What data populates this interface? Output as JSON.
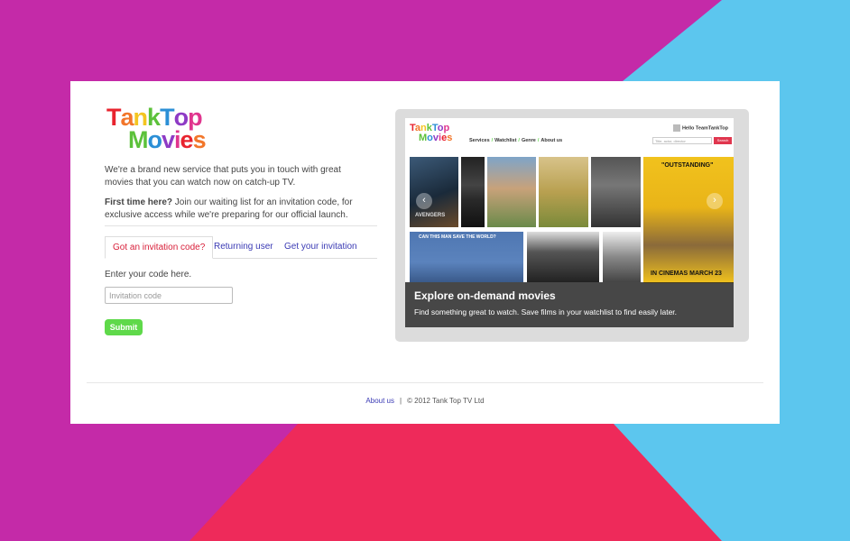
{
  "brand": {
    "line1": "TankTop",
    "line2": "Movies",
    "colors": [
      "#e8232e",
      "#f2762a",
      "#f4c520",
      "#5cc13a",
      "#2b8fd6",
      "#8e3bc5",
      "#e0358e"
    ]
  },
  "intro": {
    "text": "We're a brand new service that puts you in touch with great movies that you can watch now on catch-up TV.",
    "first_time_strong": "First time here?",
    "first_time_rest": " Join our waiting list for an invitation code, for exclusive access while we're preparing for our official launch."
  },
  "tabs": [
    {
      "label": "Got an invitation code?",
      "active": true
    },
    {
      "label": "Returning user",
      "active": false
    },
    {
      "label": "Get your invitation",
      "active": false
    }
  ],
  "form": {
    "code_label": "Enter your code here.",
    "code_placeholder": "Invitation code",
    "code_value": "",
    "submit_label": "Submit"
  },
  "preview": {
    "logo_line1": "TankTop",
    "logo_line2": "Movies",
    "nav": [
      "Services",
      "Watchlist",
      "Genre",
      "About us"
    ],
    "user_greeting": "Hello TeamTankTop",
    "search_placeholder": "Title, actor, director",
    "search_button": "Search",
    "caption_heading": "Explore on-demand movies",
    "caption_sub": "Find something great to watch. Save films in your watchlist to find easily later.",
    "poster_text_cinemas": "IN CINEMAS MARCH 23",
    "poster_text_outstanding": "\"OUTSTANDING\"",
    "poster_text_avengers": "AVENGERS",
    "poster_text_save": "CAN THIS MAN SAVE THE WORLD?"
  },
  "footer": {
    "about_label": "About us",
    "separator": "|",
    "copyright": "© 2012 Tank Top TV Ltd"
  },
  "colors": {
    "bg_magenta": "#c42aa8",
    "bg_cyan": "#5cc6ee",
    "bg_red": "#ee2a5a",
    "link_blue": "#3a3ab4",
    "active_tab_red": "#d8203a",
    "submit_green": "#5fd94a"
  }
}
